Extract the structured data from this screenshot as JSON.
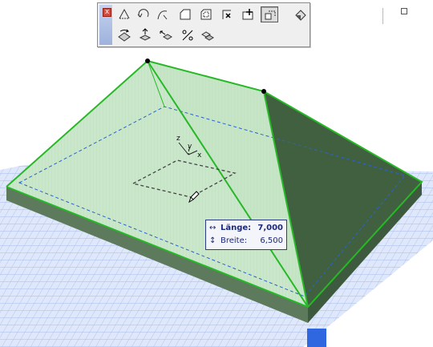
{
  "toolbar": {
    "close_label": "x",
    "row1_tools": [
      "pyramid-icon",
      "arc-roof-icon",
      "curved-roof-icon",
      "polygon-roof-icon",
      "offset-roof-icon",
      "delete-vertex-icon",
      "add-vertex-icon",
      "select-roof-icon",
      "paint-bucket-icon"
    ],
    "row2_tools": [
      "rotate-icon",
      "elevate-icon",
      "move-icon",
      "percent-slope-icon",
      "multiply-icon"
    ],
    "active_tool": "select-roof-icon"
  },
  "axis": {
    "x": "x",
    "y": "y",
    "z": "z"
  },
  "tracker": {
    "length_icon": "↔",
    "length_label": "Länge:",
    "length_value": "7,000",
    "width_icon": "↕",
    "width_label": "Breite:",
    "width_value": "6,500"
  },
  "colors": {
    "grid_blue": "#8fa8e6",
    "roof_green": "#2fae2f",
    "roof_fill": "#cfe9cf",
    "shaded_face": "#3f5f3f",
    "selection_blue": "#1a3fd4"
  }
}
